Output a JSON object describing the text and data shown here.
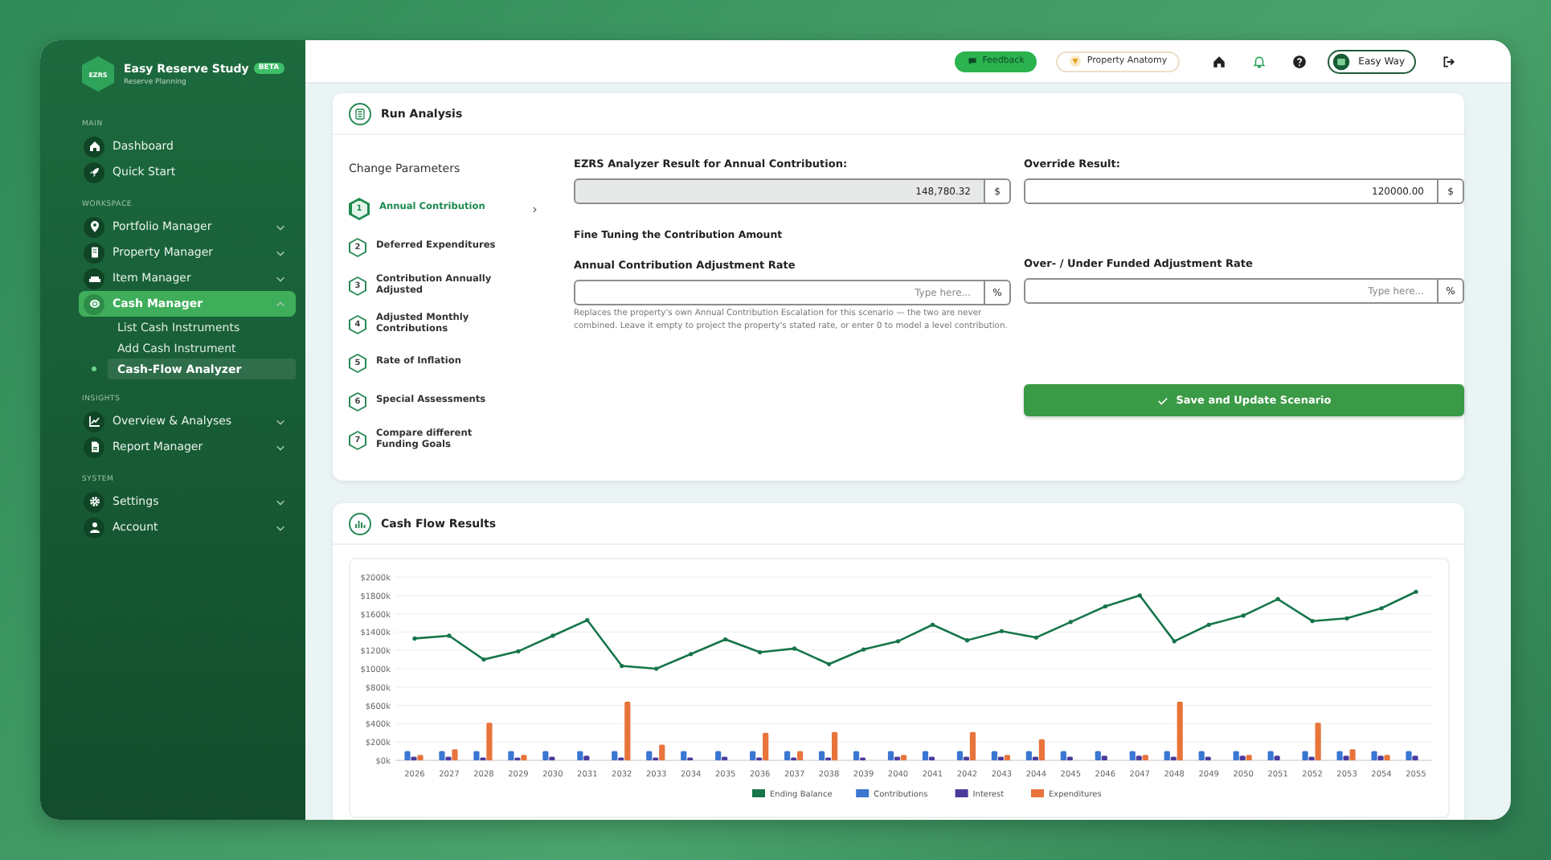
{
  "app": {
    "logo": "EZRS",
    "name": "Easy Reserve Study",
    "badge": "BETA",
    "subtitle": "Reserve Planning"
  },
  "sidebar": {
    "sections": [
      {
        "title": "MAIN",
        "items": [
          {
            "label": "Dashboard",
            "selected": false
          },
          {
            "label": "Quick Start",
            "selected": false
          }
        ]
      },
      {
        "title": "WORKSPACE",
        "items": [
          {
            "label": "Portfolio Manager",
            "selected": false,
            "expanded": false
          },
          {
            "label": "Property Manager",
            "selected": false,
            "expanded": false
          },
          {
            "label": "Item Manager",
            "selected": false,
            "expanded": false
          },
          {
            "label": "Cash Manager",
            "selected": true,
            "expanded": true,
            "children": [
              {
                "label": "List Cash Instruments",
                "selected": false
              },
              {
                "label": "Add Cash Instrument",
                "selected": false
              },
              {
                "label": "Cash-Flow Analyzer",
                "selected": true
              }
            ]
          }
        ]
      },
      {
        "title": "INSIGHTS",
        "items": [
          {
            "label": "Overview & Analyses",
            "selected": false,
            "expanded": false
          },
          {
            "label": "Report Manager",
            "selected": false,
            "expanded": false
          }
        ]
      },
      {
        "title": "SYSTEM",
        "items": [
          {
            "label": "Settings",
            "selected": false,
            "expanded": false
          },
          {
            "label": "Account",
            "selected": false,
            "expanded": false
          }
        ]
      }
    ]
  },
  "topbar": {
    "feedback": "Feedback",
    "property_anatomy": "Property Anatomy",
    "user": "Easy Way"
  },
  "run_analysis": {
    "title": "Run Analysis",
    "steps_title": "Change Parameters",
    "steps": [
      {
        "number": "1",
        "label": "Annual Contribution",
        "selected": true
      },
      {
        "number": "2",
        "label": "Deferred Expenditures",
        "selected": false
      },
      {
        "number": "3",
        "label": "Contribution Annually Adjusted",
        "selected": false
      },
      {
        "number": "4",
        "label": "Adjusted Monthly Contributions",
        "selected": false
      },
      {
        "number": "5",
        "label": "Rate of Inflation",
        "selected": false
      },
      {
        "number": "6",
        "label": "Special Assessments",
        "selected": false
      },
      {
        "number": "7",
        "label": "Compare different Funding Goals",
        "selected": false
      }
    ],
    "analyzer_result": {
      "label": "EZRS Analyzer Result for Annual Contribution:",
      "value": "148,780.32",
      "unit": "$",
      "disabled": true
    },
    "override": {
      "label": "Override Result:",
      "value": "120000.00",
      "unit": "$",
      "disabled": false
    },
    "fine_tuning_title": "Fine Tuning the Contribution Amount",
    "adjustment_rate": {
      "label": "Annual Contribution Adjustment Rate",
      "placeholder": "Type here...",
      "unit": "%",
      "disabled": false
    },
    "adjustment_help": "Replaces the property's own Annual Contribution Escalation for this scenario — the two are never combined. Leave it empty to project the property's stated rate, or enter 0 to model a level contribution.",
    "funded_rate": {
      "label": "Over- / Under Funded Adjustment Rate",
      "placeholder": "Type here...",
      "unit": "%",
      "disabled": false
    },
    "save_button": "Save and Update Scenario"
  },
  "cash_flow": {
    "title": "Cash Flow Results",
    "chart_data": {
      "type": "bar",
      "stacked": false,
      "grid": true,
      "legend": true,
      "categories": [
        "2026",
        "2027",
        "2028",
        "2029",
        "2030",
        "2031",
        "2032",
        "2033",
        "2034",
        "2035",
        "2036",
        "2037",
        "2038",
        "2039",
        "2040",
        "2041",
        "2042",
        "2043",
        "2044",
        "2045",
        "2046",
        "2047",
        "2048",
        "2049",
        "2050",
        "2051",
        "2052",
        "2053",
        "2054",
        "2055"
      ],
      "ylim": [
        0,
        2000
      ],
      "yticks": [
        {
          "value": 0,
          "label": "$0k"
        },
        {
          "value": 200,
          "label": "$200k"
        },
        {
          "value": 400,
          "label": "$400k"
        },
        {
          "value": 600,
          "label": "$600k"
        },
        {
          "value": 800,
          "label": "$800k"
        },
        {
          "value": 1000,
          "label": "$1000k"
        },
        {
          "value": 1200,
          "label": "$1200k"
        },
        {
          "value": 1400,
          "label": "$1400k"
        },
        {
          "value": 1600,
          "label": "$1600k"
        },
        {
          "value": 1800,
          "label": "$1800k"
        },
        {
          "value": 2000,
          "label": "$2000k"
        }
      ],
      "series": [
        {
          "name": "Ending Balance",
          "type": "line",
          "color": "#16754a",
          "values": [
            1330,
            1360,
            1100,
            1190,
            1360,
            1530,
            1030,
            1000,
            1160,
            1320,
            1180,
            1220,
            1050,
            1210,
            1300,
            1480,
            1310,
            1410,
            1340,
            1510,
            1680,
            1800,
            1300,
            1480,
            1580,
            1760,
            1520,
            1550,
            1660,
            1840
          ]
        },
        {
          "name": "Contributions",
          "type": "bar",
          "color": "#3a76d2",
          "values": [
            100,
            100,
            100,
            100,
            100,
            100,
            100,
            100,
            100,
            100,
            100,
            100,
            100,
            100,
            100,
            100,
            100,
            100,
            100,
            100,
            100,
            100,
            100,
            100,
            100,
            100,
            100,
            100,
            100,
            100
          ]
        },
        {
          "name": "Interest",
          "type": "bar",
          "color": "#4b3a9e",
          "values": [
            40,
            40,
            30,
            30,
            40,
            50,
            30,
            30,
            30,
            40,
            30,
            30,
            30,
            30,
            40,
            40,
            40,
            40,
            40,
            40,
            50,
            50,
            40,
            40,
            50,
            50,
            40,
            50,
            50,
            50
          ]
        },
        {
          "name": "Expenditures",
          "type": "bar",
          "color": "#e8743b",
          "values": [
            60,
            120,
            410,
            60,
            0,
            0,
            640,
            170,
            0,
            0,
            300,
            100,
            310,
            0,
            60,
            0,
            310,
            60,
            230,
            0,
            0,
            60,
            640,
            0,
            60,
            0,
            410,
            120,
            60,
            0
          ]
        }
      ]
    }
  }
}
